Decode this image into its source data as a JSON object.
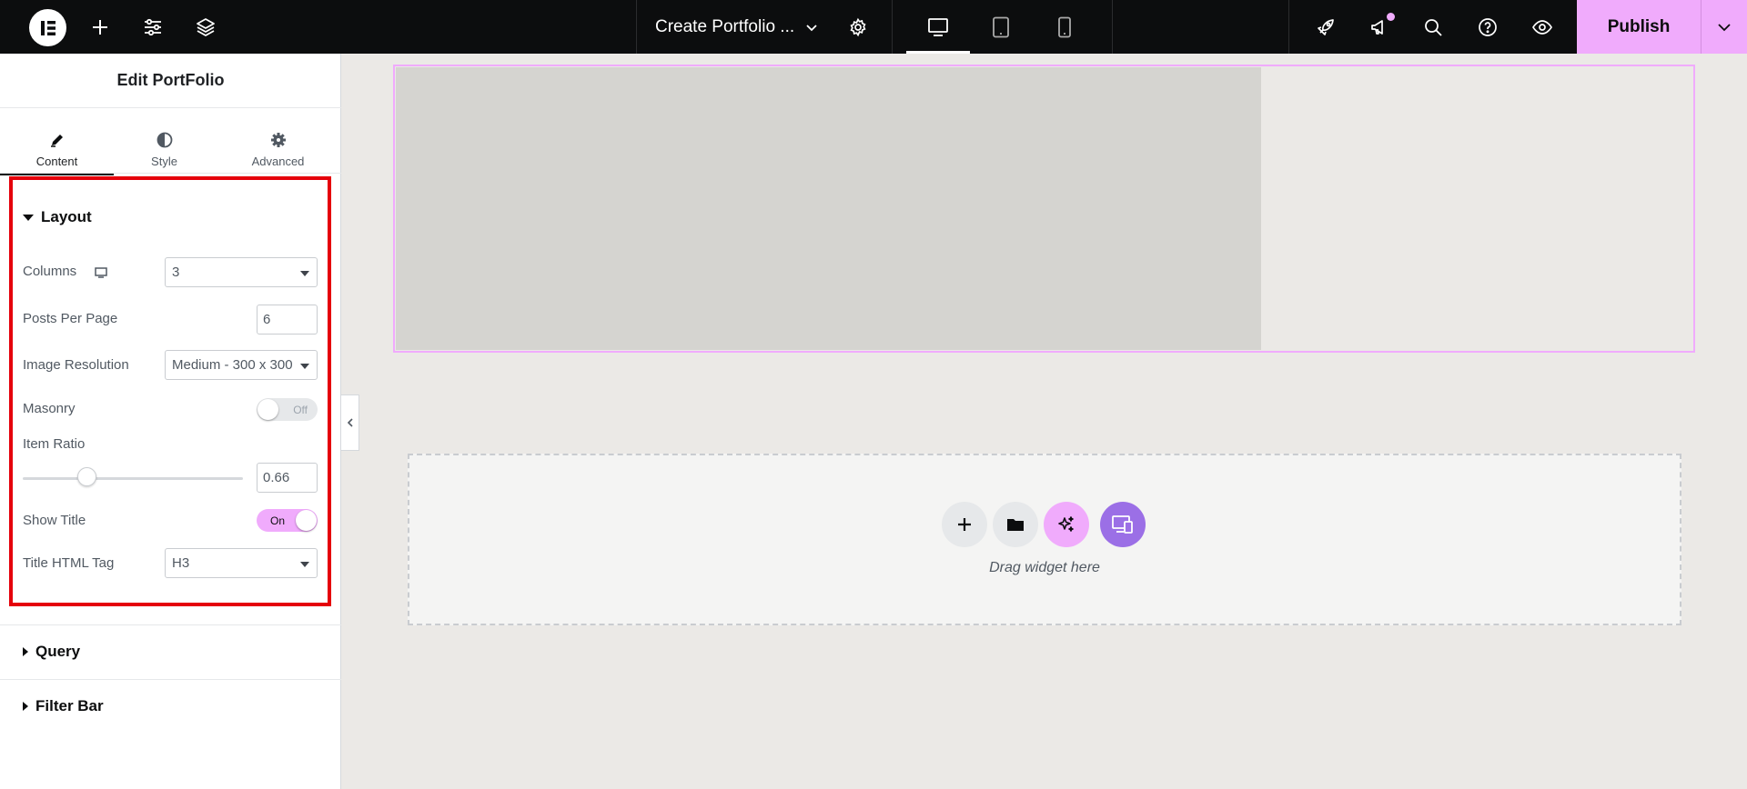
{
  "topbar": {
    "document_title": "Create Portfolio ...",
    "publish_label": "Publish",
    "accent_color": "#f0abfc",
    "icons": [
      "elementor-logo-icon",
      "add-icon",
      "site-settings-icon",
      "structure-icon",
      "chevron-down-icon",
      "gear-icon",
      "desktop-icon",
      "tablet-icon",
      "mobile-icon",
      "rocket-icon",
      "megaphone-icon",
      "search-icon",
      "help-icon",
      "eye-icon"
    ]
  },
  "panel": {
    "title": "Edit PortFolio",
    "tabs": [
      {
        "label": "Content",
        "icon": "pencil-icon",
        "active": true
      },
      {
        "label": "Style",
        "icon": "half-circle-icon",
        "active": false
      },
      {
        "label": "Advanced",
        "icon": "gear-icon",
        "active": false
      }
    ],
    "layout": {
      "section_title": "Layout",
      "columns_label": "Columns",
      "columns_value": "3",
      "posts_per_page_label": "Posts Per Page",
      "posts_per_page_value": "6",
      "image_resolution_label": "Image Resolution",
      "image_resolution_value": "Medium - 300 x 300",
      "masonry_label": "Masonry",
      "masonry_state": "Off",
      "item_ratio_label": "Item Ratio",
      "item_ratio_value": "0.66",
      "item_ratio_slider_fraction": 0.29,
      "show_title_label": "Show Title",
      "show_title_state": "On",
      "title_html_tag_label": "Title HTML Tag",
      "title_html_tag_value": "H3"
    },
    "query_title": "Query",
    "filter_bar_title": "Filter Bar"
  },
  "canvas": {
    "drag_label": "Drag widget here",
    "dropzone_buttons": [
      "add-section-icon",
      "template-library-icon",
      "ai-sparkle-icon",
      "responsive-preview-icon"
    ]
  }
}
